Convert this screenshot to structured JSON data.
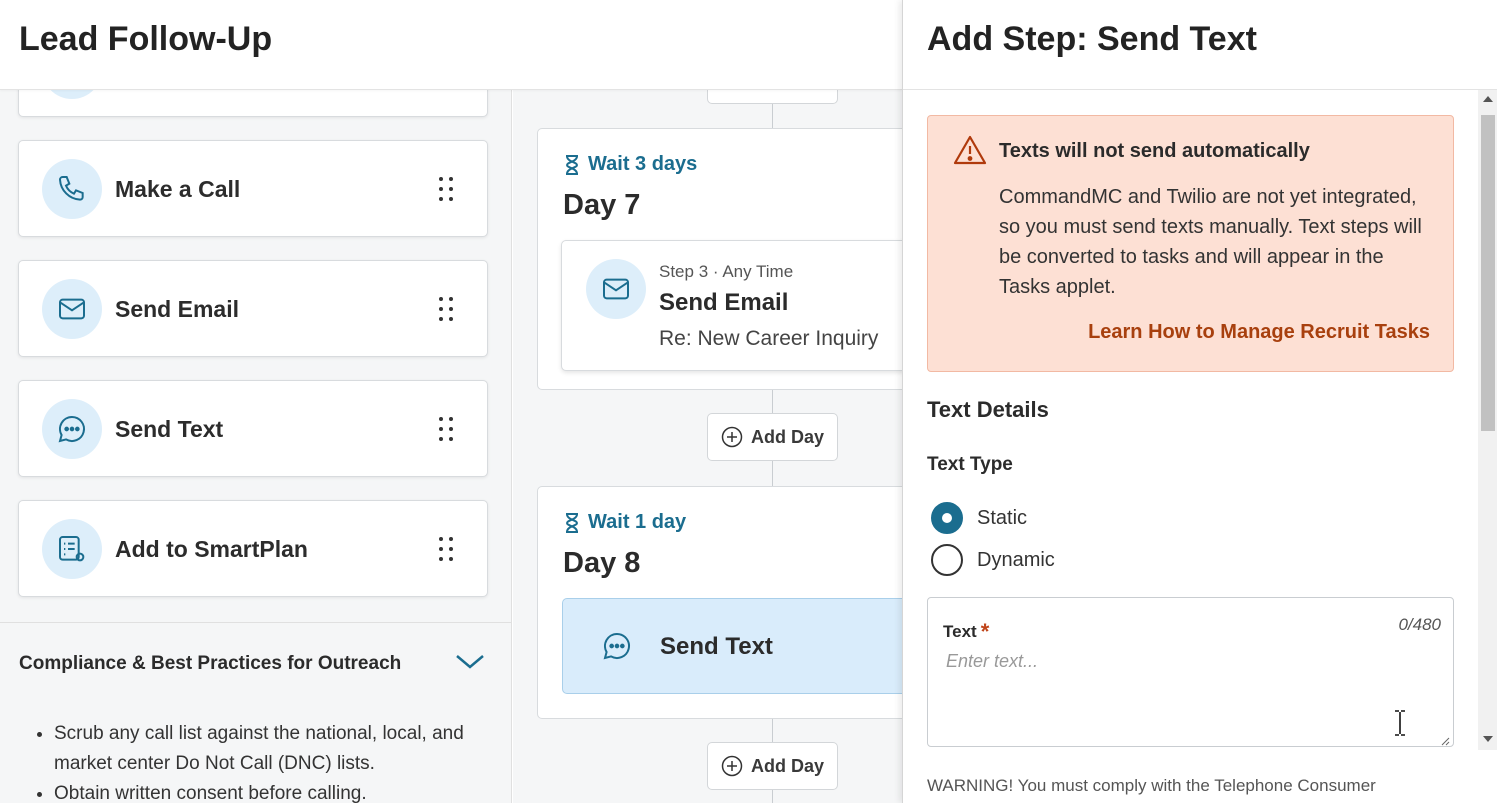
{
  "header": {
    "title": "Lead Follow-Up"
  },
  "actions": [
    {
      "label": "Make a Call",
      "icon": "phone-icon"
    },
    {
      "label": "Send Email",
      "icon": "envelope-icon"
    },
    {
      "label": "Send Text",
      "icon": "chat-bubble-icon"
    },
    {
      "label": "Add to SmartPlan",
      "icon": "smartplan-icon"
    }
  ],
  "compliance": {
    "title": "Compliance & Best Practices for Outreach",
    "items": [
      "Scrub any call list against the national, local, and market center Do Not Call (DNC) lists.",
      "Obtain written consent before calling."
    ]
  },
  "timeline": {
    "days": [
      {
        "wait": "Wait 3 days",
        "label": "Day 7",
        "step": {
          "meta": "Step 3 · Any Time",
          "name": "Send Email",
          "subject": "Re: New Career Inquiry"
        }
      },
      {
        "wait": "Wait 1 day",
        "label": "Day 8",
        "step": {
          "name": "Send Text"
        }
      }
    ],
    "add_day_label": "Add Day"
  },
  "drawer": {
    "title": "Add Step: Send Text",
    "alert": {
      "title": "Texts will not send automatically",
      "body": "CommandMC and Twilio are not yet integrated, so you must send texts manually. Text steps will be converted to tasks and will appear in the Tasks applet.",
      "link": "Learn How to Manage Recruit Tasks"
    },
    "section_title": "Text Details",
    "text_type": {
      "label": "Text Type",
      "options": [
        "Static",
        "Dynamic"
      ],
      "selected": "Static"
    },
    "text_field": {
      "label": "Text",
      "counter": "0/480",
      "placeholder": "Enter text..."
    },
    "warning": "WARNING! You must comply with the Telephone Consumer"
  },
  "colors": {
    "accent": "#1b6d8f",
    "alert_bg": "#fde0d4",
    "link": "#a8400e",
    "selected_bg": "#d9ecfb"
  }
}
